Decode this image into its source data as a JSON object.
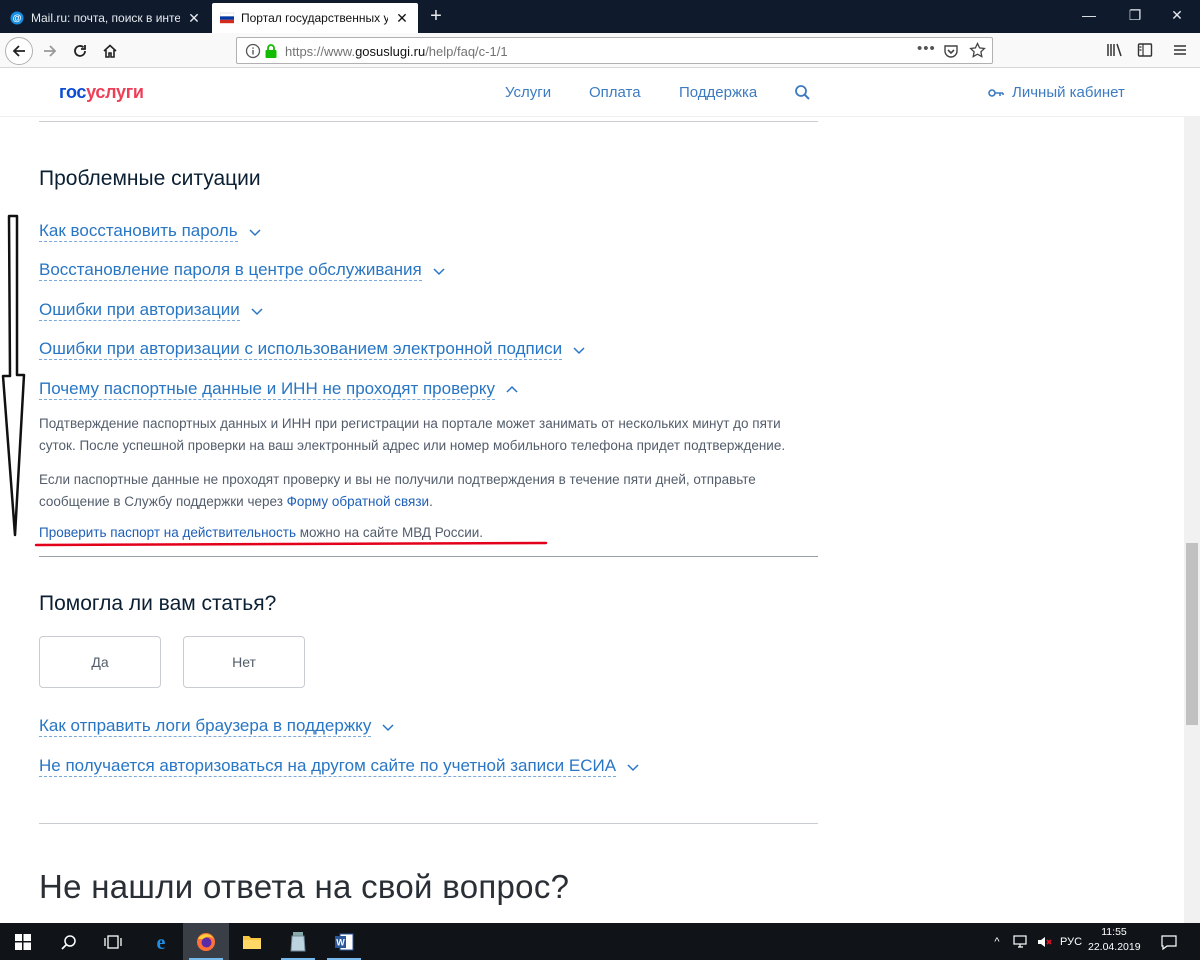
{
  "browser": {
    "tabs": [
      {
        "title": "Mail.ru: почта, поиск в интерн",
        "active": false
      },
      {
        "title": "Портал государственных услу",
        "active": true
      }
    ],
    "url": {
      "prefix": "https://www.",
      "host": "gosuslugi.ru",
      "path": "/help/faq/c-1/1"
    },
    "new_tab_glyph": "+"
  },
  "site": {
    "logo": {
      "part1": "гос",
      "part2": "услуги"
    },
    "nav": [
      "Услуги",
      "Оплата",
      "Поддержка"
    ],
    "account": "Личный кабинет"
  },
  "content": {
    "section_title": "Проблемные ситуации",
    "faq_items": [
      "Как восстановить пароль",
      "Восстановление пароля в центре обслуживания",
      "Ошибки при авторизации",
      "Ошибки при авторизации с использованием электронной подписи",
      "Почему паспортные данные и ИНН не проходят проверку"
    ],
    "answer": {
      "p1": "Подтверждение паспортных данных и ИНН при регистрации на портале может занимать от нескольких минут до пяти суток. После успешной проверки на ваш электронный адрес или номер мобильного телефона придет подтверждение.",
      "p2_text": "Если паспортные данные не проходят проверку и вы не получили подтверждения в течение пяти дней, отправьте сообщение в Службу поддержки через ",
      "p2_link": "Форму обратной связи",
      "p2_end": ".",
      "p3_link": "Проверить паспорт на действительность",
      "p3_text": " можно на сайте МВД России."
    },
    "helpful": {
      "title": "Помогла ли вам статья?",
      "yes": "Да",
      "no": "Нет"
    },
    "related": [
      "Как отправить логи браузера в поддержку",
      "Не получается авторизоваться на другом сайте по учетной записи ЕСИА"
    ],
    "not_found": "Не нашли ответа на свой вопрос?"
  },
  "taskbar": {
    "lang": "РУС",
    "time": "11:55",
    "date": "22.04.2019"
  },
  "colors": {
    "link": "#2876c4",
    "logo_blue": "#0d4cd3",
    "logo_red": "#ee3f58",
    "annotation_red": "#e3001b"
  }
}
